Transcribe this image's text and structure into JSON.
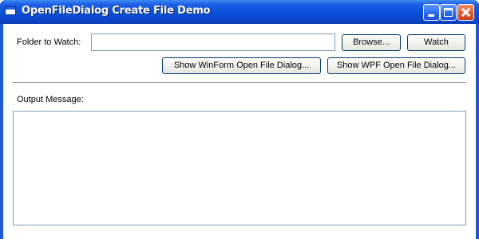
{
  "window": {
    "title": "OpenFileDialog Create File Demo"
  },
  "form": {
    "folder_label": "Folder to Watch:",
    "folder_value": "",
    "browse_label": "Browse...",
    "watch_label": "Watch",
    "winform_dialog_label": "Show WinForm Open File Dialog...",
    "wpf_dialog_label": "Show WPF Open File Dialog...",
    "output_label": "Output Message:",
    "output_value": ""
  }
}
